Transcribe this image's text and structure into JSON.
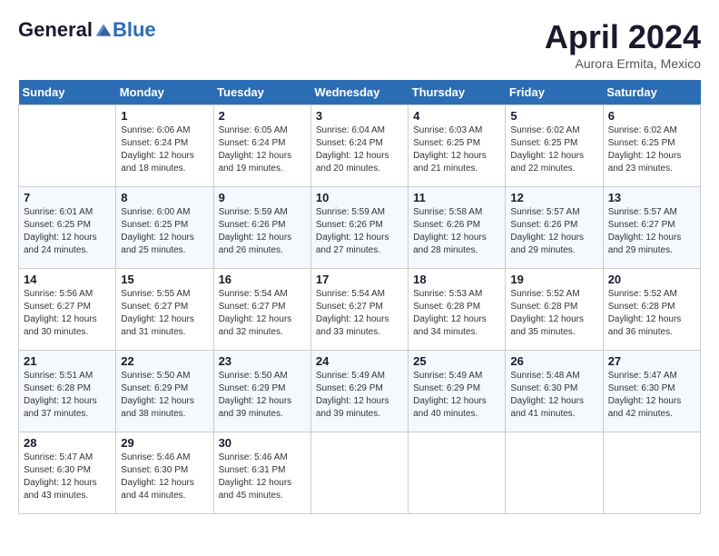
{
  "header": {
    "logo_general": "General",
    "logo_blue": "Blue",
    "month_title": "April 2024",
    "location": "Aurora Ermita, Mexico"
  },
  "weekdays": [
    "Sunday",
    "Monday",
    "Tuesday",
    "Wednesday",
    "Thursday",
    "Friday",
    "Saturday"
  ],
  "weeks": [
    [
      {
        "day": "",
        "sunrise": "",
        "sunset": "",
        "daylight": ""
      },
      {
        "day": "1",
        "sunrise": "Sunrise: 6:06 AM",
        "sunset": "Sunset: 6:24 PM",
        "daylight": "Daylight: 12 hours and 18 minutes."
      },
      {
        "day": "2",
        "sunrise": "Sunrise: 6:05 AM",
        "sunset": "Sunset: 6:24 PM",
        "daylight": "Daylight: 12 hours and 19 minutes."
      },
      {
        "day": "3",
        "sunrise": "Sunrise: 6:04 AM",
        "sunset": "Sunset: 6:24 PM",
        "daylight": "Daylight: 12 hours and 20 minutes."
      },
      {
        "day": "4",
        "sunrise": "Sunrise: 6:03 AM",
        "sunset": "Sunset: 6:25 PM",
        "daylight": "Daylight: 12 hours and 21 minutes."
      },
      {
        "day": "5",
        "sunrise": "Sunrise: 6:02 AM",
        "sunset": "Sunset: 6:25 PM",
        "daylight": "Daylight: 12 hours and 22 minutes."
      },
      {
        "day": "6",
        "sunrise": "Sunrise: 6:02 AM",
        "sunset": "Sunset: 6:25 PM",
        "daylight": "Daylight: 12 hours and 23 minutes."
      }
    ],
    [
      {
        "day": "7",
        "sunrise": "Sunrise: 6:01 AM",
        "sunset": "Sunset: 6:25 PM",
        "daylight": "Daylight: 12 hours and 24 minutes."
      },
      {
        "day": "8",
        "sunrise": "Sunrise: 6:00 AM",
        "sunset": "Sunset: 6:25 PM",
        "daylight": "Daylight: 12 hours and 25 minutes."
      },
      {
        "day": "9",
        "sunrise": "Sunrise: 5:59 AM",
        "sunset": "Sunset: 6:26 PM",
        "daylight": "Daylight: 12 hours and 26 minutes."
      },
      {
        "day": "10",
        "sunrise": "Sunrise: 5:59 AM",
        "sunset": "Sunset: 6:26 PM",
        "daylight": "Daylight: 12 hours and 27 minutes."
      },
      {
        "day": "11",
        "sunrise": "Sunrise: 5:58 AM",
        "sunset": "Sunset: 6:26 PM",
        "daylight": "Daylight: 12 hours and 28 minutes."
      },
      {
        "day": "12",
        "sunrise": "Sunrise: 5:57 AM",
        "sunset": "Sunset: 6:26 PM",
        "daylight": "Daylight: 12 hours and 29 minutes."
      },
      {
        "day": "13",
        "sunrise": "Sunrise: 5:57 AM",
        "sunset": "Sunset: 6:27 PM",
        "daylight": "Daylight: 12 hours and 29 minutes."
      }
    ],
    [
      {
        "day": "14",
        "sunrise": "Sunrise: 5:56 AM",
        "sunset": "Sunset: 6:27 PM",
        "daylight": "Daylight: 12 hours and 30 minutes."
      },
      {
        "day": "15",
        "sunrise": "Sunrise: 5:55 AM",
        "sunset": "Sunset: 6:27 PM",
        "daylight": "Daylight: 12 hours and 31 minutes."
      },
      {
        "day": "16",
        "sunrise": "Sunrise: 5:54 AM",
        "sunset": "Sunset: 6:27 PM",
        "daylight": "Daylight: 12 hours and 32 minutes."
      },
      {
        "day": "17",
        "sunrise": "Sunrise: 5:54 AM",
        "sunset": "Sunset: 6:27 PM",
        "daylight": "Daylight: 12 hours and 33 minutes."
      },
      {
        "day": "18",
        "sunrise": "Sunrise: 5:53 AM",
        "sunset": "Sunset: 6:28 PM",
        "daylight": "Daylight: 12 hours and 34 minutes."
      },
      {
        "day": "19",
        "sunrise": "Sunrise: 5:52 AM",
        "sunset": "Sunset: 6:28 PM",
        "daylight": "Daylight: 12 hours and 35 minutes."
      },
      {
        "day": "20",
        "sunrise": "Sunrise: 5:52 AM",
        "sunset": "Sunset: 6:28 PM",
        "daylight": "Daylight: 12 hours and 36 minutes."
      }
    ],
    [
      {
        "day": "21",
        "sunrise": "Sunrise: 5:51 AM",
        "sunset": "Sunset: 6:28 PM",
        "daylight": "Daylight: 12 hours and 37 minutes."
      },
      {
        "day": "22",
        "sunrise": "Sunrise: 5:50 AM",
        "sunset": "Sunset: 6:29 PM",
        "daylight": "Daylight: 12 hours and 38 minutes."
      },
      {
        "day": "23",
        "sunrise": "Sunrise: 5:50 AM",
        "sunset": "Sunset: 6:29 PM",
        "daylight": "Daylight: 12 hours and 39 minutes."
      },
      {
        "day": "24",
        "sunrise": "Sunrise: 5:49 AM",
        "sunset": "Sunset: 6:29 PM",
        "daylight": "Daylight: 12 hours and 39 minutes."
      },
      {
        "day": "25",
        "sunrise": "Sunrise: 5:49 AM",
        "sunset": "Sunset: 6:29 PM",
        "daylight": "Daylight: 12 hours and 40 minutes."
      },
      {
        "day": "26",
        "sunrise": "Sunrise: 5:48 AM",
        "sunset": "Sunset: 6:30 PM",
        "daylight": "Daylight: 12 hours and 41 minutes."
      },
      {
        "day": "27",
        "sunrise": "Sunrise: 5:47 AM",
        "sunset": "Sunset: 6:30 PM",
        "daylight": "Daylight: 12 hours and 42 minutes."
      }
    ],
    [
      {
        "day": "28",
        "sunrise": "Sunrise: 5:47 AM",
        "sunset": "Sunset: 6:30 PM",
        "daylight": "Daylight: 12 hours and 43 minutes."
      },
      {
        "day": "29",
        "sunrise": "Sunrise: 5:46 AM",
        "sunset": "Sunset: 6:30 PM",
        "daylight": "Daylight: 12 hours and 44 minutes."
      },
      {
        "day": "30",
        "sunrise": "Sunrise: 5:46 AM",
        "sunset": "Sunset: 6:31 PM",
        "daylight": "Daylight: 12 hours and 45 minutes."
      },
      {
        "day": "",
        "sunrise": "",
        "sunset": "",
        "daylight": ""
      },
      {
        "day": "",
        "sunrise": "",
        "sunset": "",
        "daylight": ""
      },
      {
        "day": "",
        "sunrise": "",
        "sunset": "",
        "daylight": ""
      },
      {
        "day": "",
        "sunrise": "",
        "sunset": "",
        "daylight": ""
      }
    ]
  ]
}
